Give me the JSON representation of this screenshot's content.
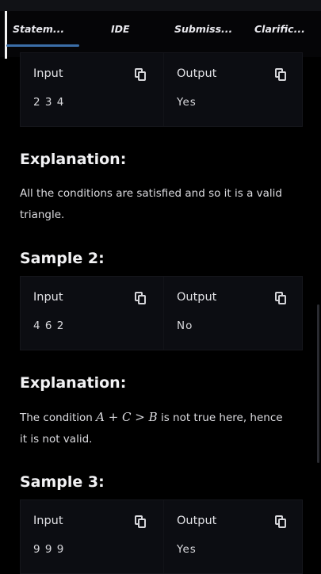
{
  "tabs": [
    {
      "label": "Statem..."
    },
    {
      "label": "IDE"
    },
    {
      "label": "Submiss..."
    },
    {
      "label": "Clarific..."
    }
  ],
  "samples": [
    {
      "input_label": "Input",
      "output_label": "Output",
      "input": "2 3 4",
      "output": "Yes"
    },
    {
      "input_label": "Input",
      "output_label": "Output",
      "input": "4 6 2",
      "output": "No"
    },
    {
      "input_label": "Input",
      "output_label": "Output",
      "input": "9 9 9",
      "output": "Yes"
    }
  ],
  "explanation1": {
    "heading": "Explanation:",
    "line1": "All the conditions are satisfied and so it is a valid",
    "line2": "triangle."
  },
  "sample2_heading": "Sample 2:",
  "explanation2": {
    "heading": "Explanation:",
    "pre": "The condition ",
    "math": "A + C > B",
    "post": " is not true here, hence",
    "line2": "it is not valid."
  },
  "sample3_heading": "Sample 3:",
  "colors": {
    "background": "#000000",
    "box": "#0c0d12",
    "tab_accent": "#3b6ea8"
  },
  "icons": {
    "copy": "copy-icon"
  }
}
